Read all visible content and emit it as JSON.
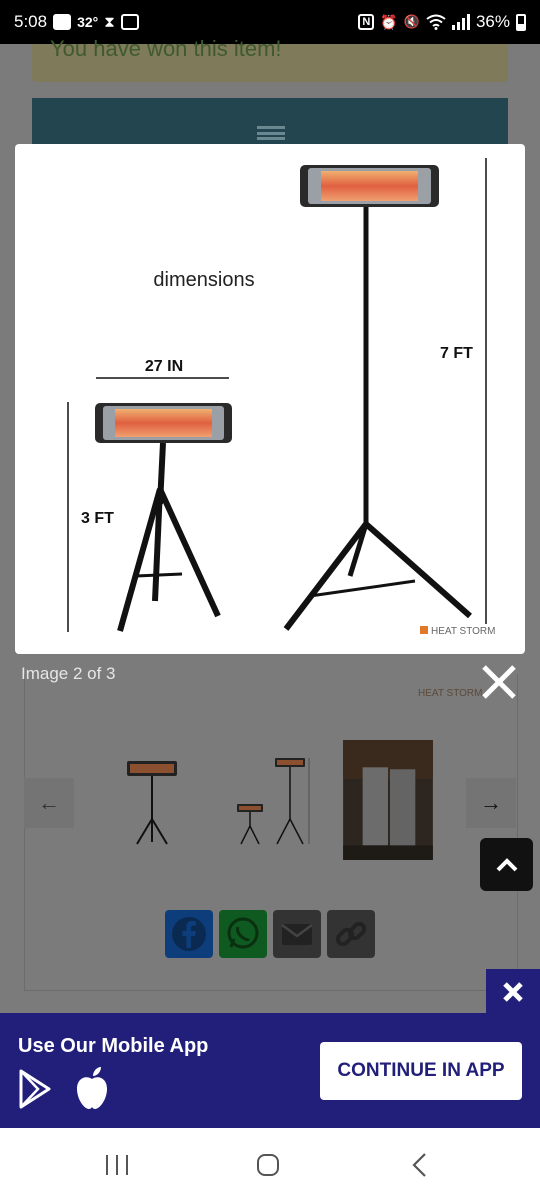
{
  "status_bar": {
    "time": "5:08",
    "temperature": "32°",
    "battery": "36%"
  },
  "page": {
    "won_message": "You have won this item!"
  },
  "lightbox": {
    "image_title": "dimensions",
    "width_label": "27 IN",
    "short_height_label": "3 FT",
    "tall_height_label": "7 FT",
    "brand": "HEAT STORM",
    "caption": "Image 2 of 3"
  },
  "gallery": {
    "prev_icon": "arrow-left-icon",
    "next_icon": "arrow-right-icon"
  },
  "share_buttons": [
    {
      "name": "facebook",
      "color": "#1877f2"
    },
    {
      "name": "whatsapp",
      "color": "#25d366"
    },
    {
      "name": "email",
      "color": "#555555"
    },
    {
      "name": "link",
      "color": "#555555"
    }
  ],
  "app_banner": {
    "title": "Use Our Mobile App",
    "continue_label": "CONTINUE IN APP",
    "background": "#221f7a"
  }
}
